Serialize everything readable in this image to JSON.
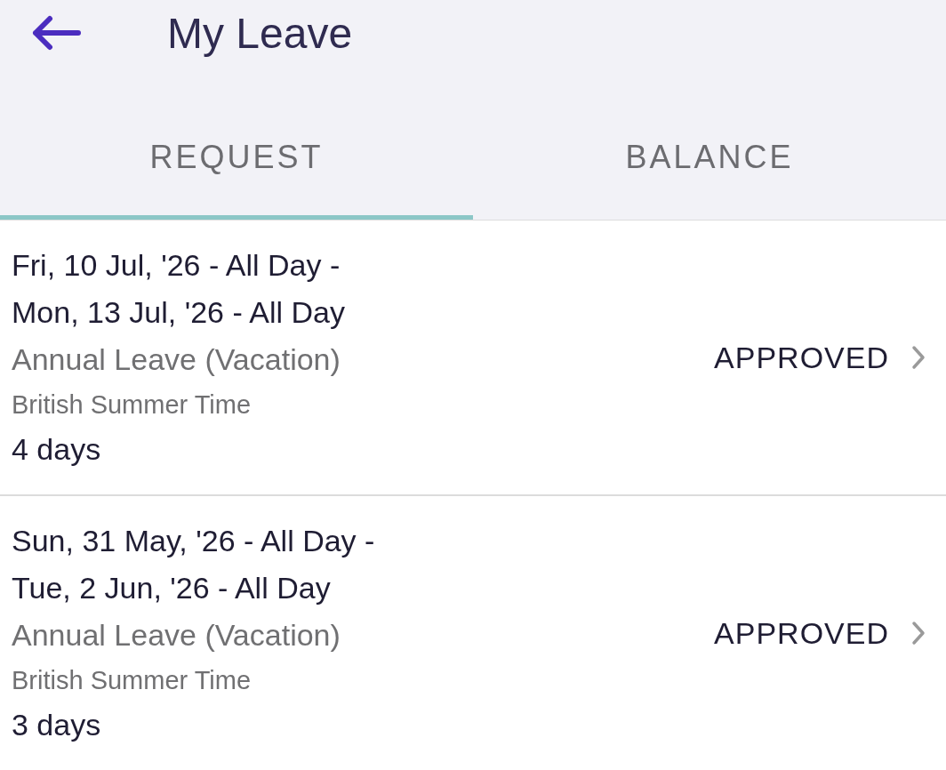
{
  "header": {
    "title": "My Leave"
  },
  "tabs": [
    {
      "label": "REQUEST",
      "selected": true
    },
    {
      "label": "BALANCE",
      "selected": false
    }
  ],
  "requests": [
    {
      "dates": [
        "Fri, 10 Jul, '26 - All Day -",
        "Mon, 13 Jul, '26 - All Day"
      ],
      "type": "Annual Leave (Vacation)",
      "timezone": "British Summer Time",
      "duration": "4 days",
      "status": "APPROVED"
    },
    {
      "dates": [
        "Sun, 31 May, '26 - All Day -",
        "Tue, 2 Jun, '26 - All Day"
      ],
      "type": "Annual Leave (Vacation)",
      "timezone": "British Summer Time",
      "duration": "3 days",
      "status": "APPROVED"
    }
  ]
}
